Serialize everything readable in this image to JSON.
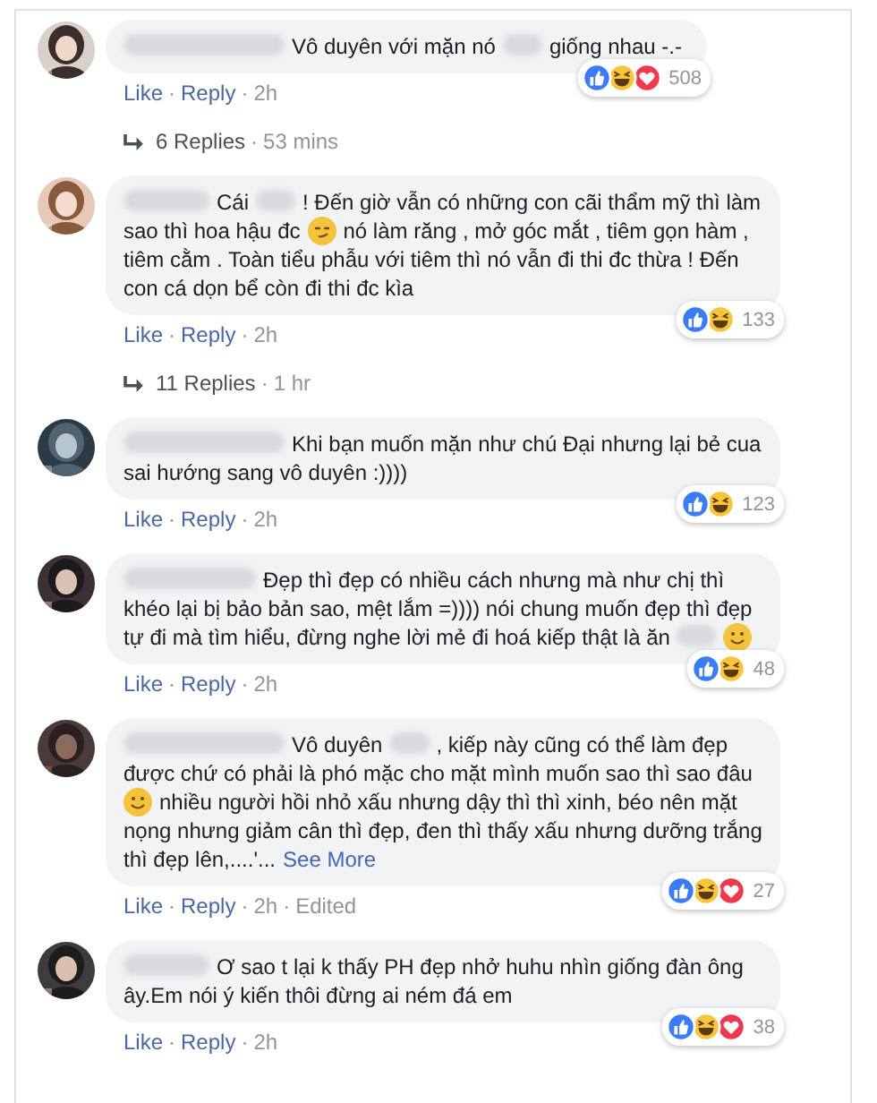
{
  "separator": "·",
  "comments": [
    {
      "parts": [
        {
          "kind": "name_blur"
        },
        {
          "kind": "text",
          "text": "Vô duyên với mặn nó"
        },
        {
          "kind": "word_blur"
        },
        {
          "kind": "text",
          "text": "giống nhau -.-"
        }
      ],
      "reactions": [
        {
          "kind": "like"
        },
        {
          "kind": "haha"
        },
        {
          "kind": "love"
        }
      ],
      "count": "508",
      "actions": [
        "Like",
        "Reply"
      ],
      "time": "2h",
      "replies": {
        "label": "6 Replies",
        "time": "53 mins"
      }
    },
    {
      "parts": [
        {
          "kind": "short_blur"
        },
        {
          "kind": "text",
          "text": "Cái"
        },
        {
          "kind": "word_blur"
        },
        {
          "kind": "text",
          "text": "! Đến giờ vẫn có những con cãi thẩm mỹ thì làm sao thì hoa hậu đc"
        },
        {
          "kind": "smirk"
        },
        {
          "kind": "text",
          "text": "nó làm răng , mở góc mắt , tiêm gọn hàm , tiêm cằm . Toàn tiểu phẫu với tiêm thì nó vẫn đi thi đc thừa ! Đến con cá dọn bể còn đi thi đc kìa"
        }
      ],
      "reactions": [
        {
          "kind": "like"
        },
        {
          "kind": "haha"
        }
      ],
      "count": "133",
      "actions": [
        "Like",
        "Reply"
      ],
      "time": "2h",
      "replies": {
        "label": "11 Replies",
        "time": "1 hr"
      }
    },
    {
      "parts": [
        {
          "kind": "name_blur"
        },
        {
          "kind": "text",
          "text": "Khi bạn muốn mặn như chú Đại nhưng lại bẻ cua sai hướng sang vô duyên :))))"
        }
      ],
      "reactions": [
        {
          "kind": "like"
        },
        {
          "kind": "haha"
        }
      ],
      "count": "123",
      "actions": [
        "Like",
        "Reply"
      ],
      "time": "2h"
    },
    {
      "parts": [
        {
          "kind": "long_blur"
        },
        {
          "kind": "text",
          "text": "Đẹp thì đẹp có nhiều cách nhưng mà như chị thì khéo lại bị bảo bản sao, mệt lắm =)))) nói chung muốn đẹp thì đẹp tự đi mà tìm hiểu, đừng nghe lời mẻ đi hoá kiếp thật là ăn"
        },
        {
          "kind": "word_blur"
        },
        {
          "kind": "smile"
        }
      ],
      "reactions": [
        {
          "kind": "like"
        },
        {
          "kind": "haha"
        }
      ],
      "count": "48",
      "actions": [
        "Like",
        "Reply"
      ],
      "time": "2h"
    },
    {
      "parts": [
        {
          "kind": "name_blur"
        },
        {
          "kind": "text",
          "text": "Vô duyên"
        },
        {
          "kind": "word_blur"
        },
        {
          "kind": "text",
          "text": ", kiếp này cũng có thể làm đẹp được chứ có phải là phó mặc cho mặt mình muốn sao thì sao đâu"
        },
        {
          "kind": "smile"
        },
        {
          "kind": "text",
          "text": "nhiều người hồi nhỏ xấu nhưng dậy thì thì xinh, béo nên mặt nọng nhưng giảm cân thì đẹp, đen thì thấy xấu nhưng dưỡng trắng thì đẹp lên,....'..."
        },
        {
          "kind": "link",
          "text": "See More"
        }
      ],
      "reactions": [
        {
          "kind": "like"
        },
        {
          "kind": "haha"
        },
        {
          "kind": "love"
        }
      ],
      "count": "27",
      "actions": [
        "Like",
        "Reply"
      ],
      "time": "2h",
      "edited": "Edited"
    },
    {
      "parts": [
        {
          "kind": "short_blur"
        },
        {
          "kind": "text",
          "text": "Ơ sao t lại k thấy PH đẹp nhở huhu nhìn giống đàn ông ây.Em nói ý kiến thôi đừng ai ném đá em"
        }
      ],
      "reactions": [
        {
          "kind": "like"
        },
        {
          "kind": "haha"
        },
        {
          "kind": "love"
        }
      ],
      "count": "38",
      "actions": [
        "Like",
        "Reply"
      ],
      "time": "2h"
    }
  ]
}
